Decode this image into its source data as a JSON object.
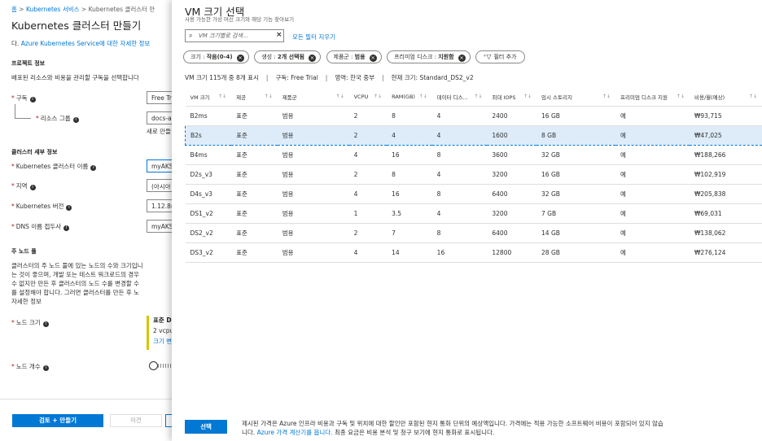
{
  "left": {
    "breadcrumb": [
      "홈",
      "Kubernetes 서비스",
      "Kubernetes 클러스터 만"
    ],
    "breadcrumb_sep": ">",
    "title": "Kubernetes 클러스터 만들기",
    "intro_prefix": "다.",
    "intro_link": "Azure Kubernetes Service에 대한 자세한 정보",
    "project_section": "프로젝트 정보",
    "project_desc": "배포된 리소스와 비용을 관리할 구독을 선택합니다",
    "subscription_label": "구독",
    "subscription_value": "Free Tri",
    "resource_group_label": "리소스 그룹",
    "resource_group_value": "docs-ai",
    "create_new_link": "새로 만들",
    "cluster_section": "클러스터 세부 정보",
    "cluster_name_label": "Kubernetes 클러스터 이름",
    "cluster_name_value": "myAKS",
    "region_label": "지역",
    "region_value": "(아시아",
    "version_label": "Kubernetes 버전",
    "version_value": "1.12.8(",
    "dns_label": "DNS 이름 접두사",
    "dns_value": "myAKS",
    "pool_section": "주 노드 풀",
    "pool_desc": [
      "클러스터의 주 노드 풀에 있는 노드의 수와 크기입니",
      "는 것이 좋으며, 개발 또는 테스트 워크로드의 경우",
      "수 없지만 만든 후 클러스터의 노드 수를 변경할 수",
      "를 설정해야 합니다. 그러면 클러스터를 만든 후 노"
    ],
    "pool_link": "자세한 정보",
    "node_size_label": "노드 크기",
    "node_size_title": "표준 D",
    "node_size_sub": "2 vcpu",
    "node_size_link": "크기 변",
    "node_count_label": "노드 개수",
    "review_button": "검토 + 만들기",
    "prev_button": "이전"
  },
  "panel": {
    "title": "VM 크기 선택",
    "subtitle": "사용 가능한 가상 머신 크기와 해당 기능 찾아보기",
    "search_placeholder": "VM 크기별로 검색...",
    "clear_filters": "모든 필터 지우기",
    "filters": [
      {
        "label": "크기 : ",
        "value": "작음(0-4)"
      },
      {
        "label": "생성 : ",
        "value": "2개 선택됨"
      },
      {
        "label": "제품군 : ",
        "value": "범용"
      },
      {
        "label": "프리미엄 디스크 : ",
        "value": "지원함"
      }
    ],
    "add_filter": "필터 추가",
    "summary": {
      "count": "VM 크기 115개 중 8개 표시",
      "subscription": "구독: Free Trial",
      "region": "영역: 한국 중부",
      "current": "현재 크기: Standard_DS2_v2"
    },
    "columns": [
      "VM 크기",
      "제공",
      "제품군",
      "VCPU",
      "RAM(GB)",
      "데이터 디스...",
      "최대 IOPS",
      "임시 스토리지",
      "프리미엄 디스크 지원",
      "비용/월(예상)"
    ],
    "rows": [
      [
        "B2ms",
        "표준",
        "범용",
        "2",
        "8",
        "4",
        "2400",
        "16 GB",
        "예",
        "₩93,715"
      ],
      [
        "B2s",
        "표준",
        "범용",
        "2",
        "4",
        "4",
        "1600",
        "8 GB",
        "예",
        "₩47,025"
      ],
      [
        "B4ms",
        "표준",
        "범용",
        "4",
        "16",
        "8",
        "3600",
        "32 GB",
        "예",
        "₩188,266"
      ],
      [
        "D2s_v3",
        "표준",
        "범용",
        "2",
        "8",
        "4",
        "3200",
        "16 GB",
        "예",
        "₩102,919"
      ],
      [
        "D4s_v3",
        "표준",
        "범용",
        "4",
        "16",
        "8",
        "6400",
        "32 GB",
        "예",
        "₩205,838"
      ],
      [
        "DS1_v2",
        "표준",
        "범용",
        "1",
        "3.5",
        "4",
        "3200",
        "7 GB",
        "예",
        "₩69,031"
      ],
      [
        "DS2_v2",
        "표준",
        "범용",
        "2",
        "7",
        "8",
        "6400",
        "14 GB",
        "예",
        "₩138,062"
      ],
      [
        "DS3_v2",
        "표준",
        "범용",
        "4",
        "14",
        "16",
        "12800",
        "28 GB",
        "예",
        "₩276,124"
      ]
    ],
    "selected_row": "B2s",
    "select_button": "선택",
    "footnote_line1": "제시된 가격은 Azure 인프라 비용과 구독 및 위치에 대한 할인만 포함된 현지 통화 단위의 예상액입니다. 가격에는 적용 가능한 소프트웨어 비용이 포함되어 있지 않습",
    "footnote_line2_prefix": "니다.",
    "footnote_link": "Azure 가격 계산기를 봅니다.",
    "footnote_line2_suffix": "최종 요금은 비용 분석 및 청구 보기에 현지 통화로 표시됩니다."
  },
  "icons": {
    "search": "search-icon",
    "clear": "close-icon",
    "filter_remove": "close-circle-icon",
    "add_filter": "filter-add-icon",
    "info": "info-icon",
    "sort": "sort-icon"
  },
  "colors": {
    "accent": "#0078d4",
    "required": "#a4262c",
    "selected_row": "#deecf9",
    "node_size_bar": "#d7c500"
  }
}
